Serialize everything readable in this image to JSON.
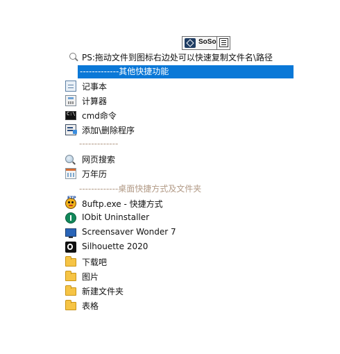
{
  "toolbar": {
    "app_label": "SoSo",
    "app_icon": "soso-logo-icon",
    "menu_icon": "hamburger-menu-icon"
  },
  "hint": {
    "icon": "search-icon",
    "text": "PS:拖动文件到图标右边处可以快速复制文件名\\路径"
  },
  "sections": {
    "other_header": "-------------其他快捷功能",
    "separator": "-------------",
    "desktop_header": "-------------桌面快捷方式及文件夹"
  },
  "items": [
    {
      "label": "记事本",
      "icon": "notepad-icon"
    },
    {
      "label": "计算器",
      "icon": "calculator-icon"
    },
    {
      "label": "cmd命令",
      "icon": "cmd-icon"
    },
    {
      "label": "添加\\删除程序",
      "icon": "programs-icon"
    },
    {
      "label": "网页搜索",
      "icon": "web-search-icon"
    },
    {
      "label": "万年历",
      "icon": "calendar-icon"
    },
    {
      "label": "8uftp.exe - 快捷方式",
      "icon": "8uftp-icon",
      "icon_tag": "FTP"
    },
    {
      "label": "IObit Uninstaller",
      "icon": "iobit-icon"
    },
    {
      "label": "Screensaver Wonder 7",
      "icon": "screensaver-icon"
    },
    {
      "label": "Silhouette 2020",
      "icon": "silhouette-icon"
    },
    {
      "label": "下载吧",
      "icon": "folder-icon"
    },
    {
      "label": "图片",
      "icon": "folder-icon"
    },
    {
      "label": "新建文件夹",
      "icon": "folder-icon"
    },
    {
      "label": "表格",
      "icon": "folder-icon"
    }
  ],
  "colors": {
    "highlight": "#0a78d7",
    "separator_text": "#b29a86"
  }
}
